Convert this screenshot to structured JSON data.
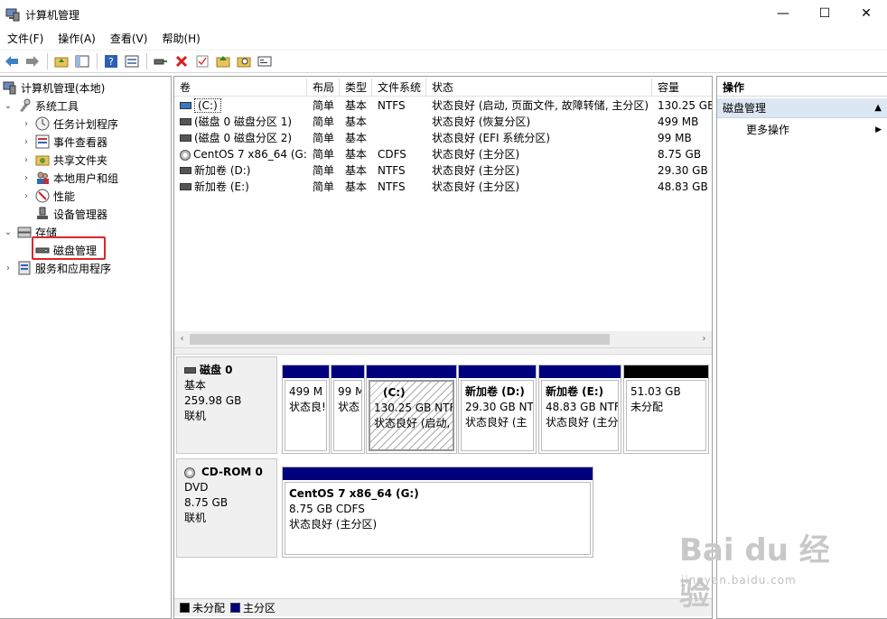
{
  "window": {
    "title": "计算机管理",
    "controls": [
      "—",
      "☐",
      "✕"
    ]
  },
  "menu": [
    "文件(F)",
    "操作(A)",
    "查看(V)",
    "帮助(H)"
  ],
  "tree": {
    "root": "计算机管理(本地)",
    "system_tools": "系统工具",
    "task_scheduler": "任务计划程序",
    "event_viewer": "事件查看器",
    "shared_folders": "共享文件夹",
    "local_users": "本地用户和组",
    "performance": "性能",
    "device_manager": "设备管理器",
    "storage": "存储",
    "disk_management": "磁盘管理",
    "services": "服务和应用程序"
  },
  "volume_table": {
    "headers": [
      "卷",
      "布局",
      "类型",
      "文件系统",
      "状态",
      "容量"
    ],
    "rows": [
      [
        "(C:)",
        "简单",
        "基本",
        "NTFS",
        "状态良好 (启动, 页面文件, 故障转储, 主分区)",
        "130.25 GB"
      ],
      [
        "(磁盘 0 磁盘分区 1)",
        "简单",
        "基本",
        "",
        "状态良好 (恢复分区)",
        "499 MB"
      ],
      [
        "(磁盘 0 磁盘分区 2)",
        "简单",
        "基本",
        "",
        "状态良好 (EFI 系统分区)",
        "99 MB"
      ],
      [
        "CentOS 7 x86_64 (G:)",
        "简单",
        "基本",
        "CDFS",
        "状态良好 (主分区)",
        "8.75 GB"
      ],
      [
        "新加卷 (D:)",
        "简单",
        "基本",
        "NTFS",
        "状态良好 (主分区)",
        "29.30 GB"
      ],
      [
        "新加卷 (E:)",
        "简单",
        "基本",
        "NTFS",
        "状态良好 (主分区)",
        "48.83 GB"
      ]
    ]
  },
  "disk0": {
    "name": "磁盘 0",
    "type": "基本",
    "size": "259.98 GB",
    "status": "联机",
    "partitions": [
      {
        "name": "",
        "line1": "499 M",
        "line2": "状态良!"
      },
      {
        "name": "",
        "line1": "99 M",
        "line2": "状态"
      },
      {
        "name": "(C:)",
        "line1": "130.25 GB NTF",
        "line2": "状态良好 (启动, ;"
      },
      {
        "name": "新加卷  (D:)",
        "line1": "29.30 GB NT",
        "line2": "状态良好 (主"
      },
      {
        "name": "新加卷  (E:)",
        "line1": "48.83 GB NTF",
        "line2": "状态良好 (主分"
      },
      {
        "name": "",
        "line1": "51.03 GB",
        "line2": "未分配"
      }
    ]
  },
  "cdrom0": {
    "name": "CD-ROM 0",
    "type": "DVD",
    "size": "8.75 GB",
    "status": "联机",
    "partition": {
      "name": "CentOS 7 x86_64  (G:)",
      "line1": "8.75 GB CDFS",
      "line2": "状态良好 (主分区)"
    }
  },
  "legend": {
    "unallocated": "未分配",
    "primary": "主分区",
    "unallocated_color": "#000000",
    "primary_color": "#00007f"
  },
  "actions": {
    "header": "操作",
    "section": "磁盘管理",
    "more": "更多操作"
  },
  "watermark": {
    "main": "Bai du 经验",
    "sub": "jingyan.baidu.com"
  }
}
